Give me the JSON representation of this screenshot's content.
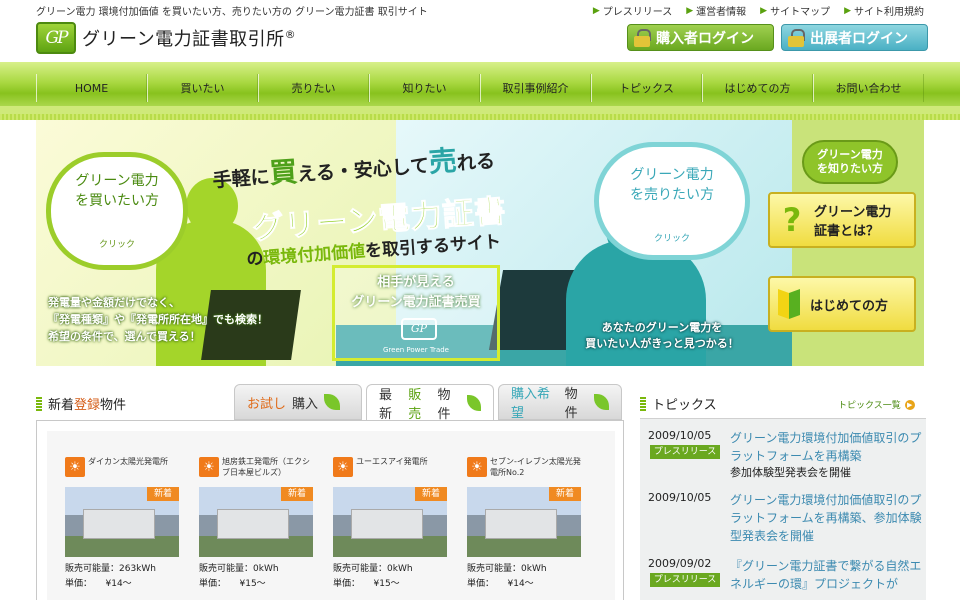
{
  "header": {
    "tagline": "グリーン電力 環境付加価値 を買いたい方、売りたい方の グリーン電力証書 取引サイト",
    "logo_mark": "GP",
    "logo_text": "グリーン電力証書取引所",
    "logo_reg": "®",
    "util_links": [
      "プレスリリース",
      "運営者情報",
      "サイトマップ",
      "サイト利用規約"
    ],
    "buyer_login": "購入者ログイン",
    "seller_login": "出展者ログイン"
  },
  "nav": [
    "HOME",
    "買いたい",
    "売りたい",
    "知りたい",
    "取引事例紹介",
    "トピックス",
    "はじめての方",
    "お問い合わせ"
  ],
  "hero": {
    "buy_bubble": [
      "グリーン電力",
      "を買いたい方"
    ],
    "buy_click": "クリック",
    "sell_bubble": [
      "グリーン電力",
      "を売りたい方"
    ],
    "sell_click": "クリック",
    "catch_pre": "手軽に",
    "catch_buy": "買",
    "catch_mid": "える・安心して",
    "catch_sell": "売",
    "catch_post": "れる",
    "headline": "グリーン電力証書",
    "subline_pre": "の",
    "subline_hl": "環境付加価値",
    "subline_post": "を取引するサイト",
    "trade_line1": "相手が見える",
    "trade_line2": "グリーン電力証書売買",
    "trade_logo": "GP",
    "trade_caption": "Green Power Trade",
    "copy_left": [
      "発電量や金額だけでなく、",
      "『発電種類』や『発電所所在地』でも検索！",
      "希望の条件で、選んで買える！"
    ],
    "copy_right": [
      "あなたのグリーン電力を",
      "買いたい人がきっと見つかる！"
    ],
    "side_bubble": [
      "グリーン電力",
      "を知りたい方"
    ],
    "side_what": [
      "グリーン電力",
      "証書とは？"
    ],
    "side_first": "はじめての方"
  },
  "listings": {
    "title_pre": "新着",
    "title_hl": "登録",
    "title_post": "物件",
    "tabs": [
      {
        "pre": "お試し",
        "em": "",
        "post": "購入"
      },
      {
        "pre": "最新",
        "em": "販売",
        "post": "物件"
      },
      {
        "pre": "",
        "em": "購入希望",
        "post": "物件"
      }
    ],
    "badge": "新着",
    "cards": [
      {
        "name": "ダイカン太陽光発電所",
        "line1": "販売可能量：263kWh",
        "line2": "単価：　　¥14～"
      },
      {
        "name": "旭房鉄工発電所（エクシブ日本屋ビルズ）",
        "line1": "販売可能量：0kWh",
        "line2": "単価：　　¥15～"
      },
      {
        "name": "ユーエスアイ発電所",
        "line1": "販売可能量：0kWh",
        "line2": "単価：　　¥15～"
      },
      {
        "name": "セブン-イレブン太陽光発電所No.2",
        "line1": "販売可能量：0kWh",
        "line2": "単価：　　¥14～"
      }
    ]
  },
  "topics": {
    "title": "トピックス",
    "more": "トピックス一覧",
    "items": [
      {
        "date": "2009/10/05",
        "badge": "プレスリリース",
        "text": "グリーン電力環境付加価値取引のプラットフォームを再構築",
        "sub": "参加体験型発表会を開催"
      },
      {
        "date": "2009/10/05",
        "badge": "",
        "text": "グリーン電力環境付加価値取引のプラットフォームを再構築、参加体験型発表会を開催",
        "sub": ""
      },
      {
        "date": "2009/09/02",
        "badge": "プレスリリース",
        "text": "『グリーン電力証書で繋がる自然エネルギーの環』プロジェクトが",
        "sub": ""
      }
    ]
  }
}
